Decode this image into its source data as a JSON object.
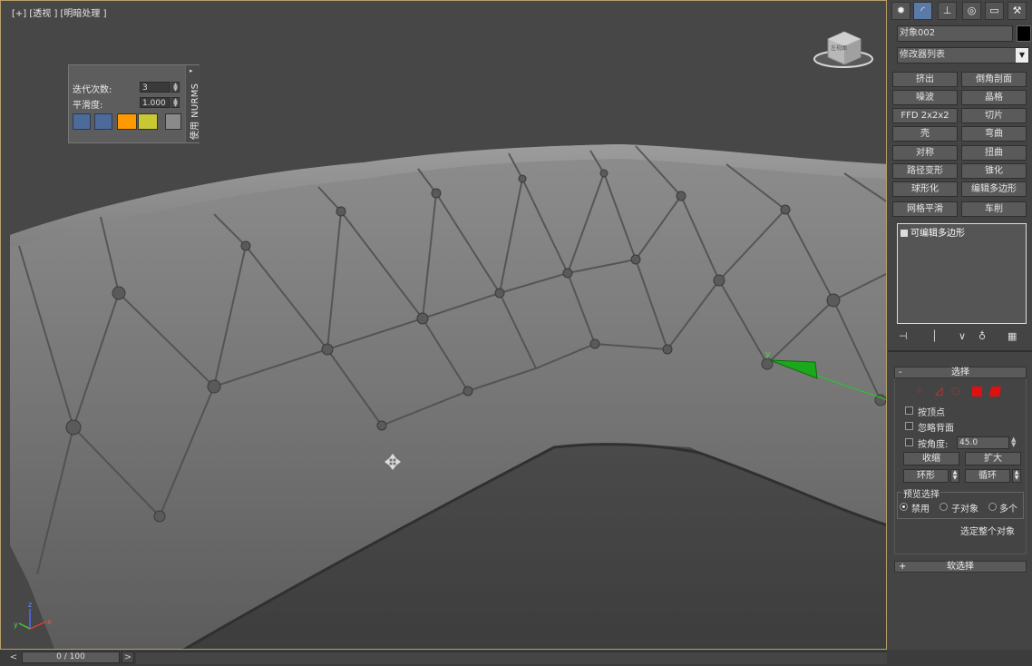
{
  "viewport": {
    "label": "[+] [透视 ] [明暗处理 ]"
  },
  "nurms_panel": {
    "iterations_label": "迭代次数:",
    "iterations_value": "3",
    "smoothness_label": "平滑度:",
    "smoothness_value": "1.000",
    "vertical_tab": "使用 NURMS",
    "colors": {
      "orange": "#ff9900",
      "yellow": "#c8c832"
    }
  },
  "viewcube": {
    "label": "左视面"
  },
  "timeline": {
    "prev": "<",
    "frame": "0 / 100",
    "next": ">"
  },
  "command_panel": {
    "tabs": [
      "create-icon",
      "modify-icon",
      "hierarchy-icon",
      "motion-icon",
      "display-icon",
      "utilities-icon"
    ],
    "object_name": "对象002",
    "object_color": "#000000",
    "modifier_list": "修改器列表",
    "modifier_buttons": [
      [
        "挤出",
        "倒角剖面"
      ],
      [
        "噪波",
        "晶格"
      ],
      [
        "FFD 2x2x2",
        "切片"
      ],
      [
        "壳",
        "弯曲"
      ],
      [
        "对称",
        "扭曲"
      ],
      [
        "路径变形",
        "锥化"
      ],
      [
        "球形化",
        "编辑多边形"
      ],
      [
        "网格平滑",
        "车削"
      ]
    ],
    "stack_item": "可编辑多边形",
    "selection": {
      "header_minus": "-",
      "title": "选择",
      "by_vertex": "按顶点",
      "ignore_backfacing": "忽略背面",
      "by_angle": "按角度:",
      "angle_value": "45.0",
      "shrink": "收缩",
      "grow": "扩大",
      "ring": "环形",
      "loop": "循环",
      "preview_title": "预览选择",
      "preview_disabled": "禁用",
      "preview_subobject": "子对象",
      "preview_multi": "多个",
      "select_whole": "选定整个对象"
    },
    "soft_selection": {
      "header_plus": "+",
      "title": "软选择"
    }
  }
}
